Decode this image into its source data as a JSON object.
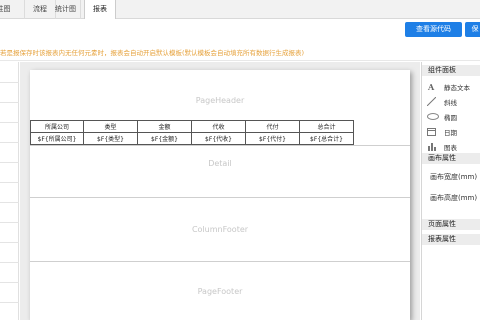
{
  "tabs": [
    {
      "label": "属性图"
    },
    {
      "label": "流程"
    },
    {
      "label": "统计图"
    },
    {
      "label": "报表"
    }
  ],
  "toolbar": {
    "view_source_label": "查看源代码",
    "save_label": "保"
  },
  "warning": {
    "text": "若是报保存时该报表内无任何元素时，报表会自动开启默认模板(默认模板会自动填充所有数据行生成报表)",
    "color": "#e6a23c"
  },
  "report": {
    "bands": {
      "page_header": "PageHeader",
      "detail": "Detail",
      "column_footer": "ColumnFooter",
      "page_footer": "PageFooter"
    },
    "headers": [
      "所属公司",
      "类型",
      "金额",
      "代收",
      "代付",
      "总合计"
    ],
    "fields": [
      "$F{所属公司}",
      "$F{类型}",
      "$F{金额}",
      "$F{代收}",
      "$F{代付}",
      "$F{总合计}"
    ]
  },
  "sidebar": {
    "components_title": "组件面板",
    "components": [
      {
        "label": "静态文本",
        "icon": "static-text-icon"
      },
      {
        "label": "斜线",
        "icon": "diagonal-line-icon"
      },
      {
        "label": "椭圆",
        "icon": "ellipse-icon"
      },
      {
        "label": "日期",
        "icon": "date-icon"
      },
      {
        "label": "图表",
        "icon": "chart-icon"
      }
    ],
    "canvas_props_title": "画布属性",
    "canvas_width_label": "画布宽度(mm)",
    "canvas_height_label": "画布高度(mm)",
    "page_props_title": "页面属性",
    "report_props_title": "报表属性"
  },
  "colors": {
    "primary": "#1e7fe6",
    "warning": "#e6a23c"
  }
}
